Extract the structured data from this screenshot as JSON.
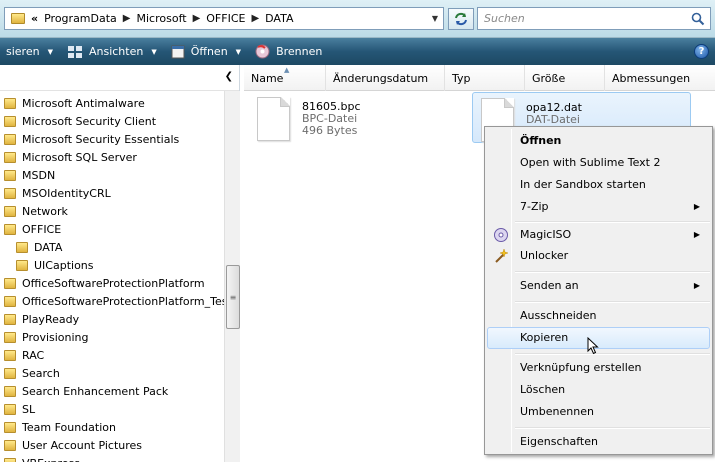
{
  "address": {
    "chevron": "«",
    "crumbs": [
      "ProgramData",
      "Microsoft",
      "OFFICE",
      "DATA"
    ],
    "separator": "▶",
    "dropdown": "▼"
  },
  "search": {
    "placeholder": "Suchen"
  },
  "toolbar": {
    "organize_label": "sieren",
    "views_label": "Ansichten",
    "open_label": "Öffnen",
    "burn_label": "Brennen",
    "arrow": "▼",
    "help_label": "?"
  },
  "nav": {
    "chevron": "❮",
    "items": [
      {
        "label": "Microsoft Antimalware"
      },
      {
        "label": "Microsoft Security Client"
      },
      {
        "label": "Microsoft Security Essentials"
      },
      {
        "label": "Microsoft SQL Server"
      },
      {
        "label": "MSDN"
      },
      {
        "label": "MSOIdentityCRL"
      },
      {
        "label": "Network"
      },
      {
        "label": "OFFICE"
      },
      {
        "label": "DATA"
      },
      {
        "label": "UICaptions"
      },
      {
        "label": "OfficeSoftwareProtectionPlatform"
      },
      {
        "label": "OfficeSoftwareProtectionPlatform_Test"
      },
      {
        "label": "PlayReady"
      },
      {
        "label": "Provisioning"
      },
      {
        "label": "RAC"
      },
      {
        "label": "Search"
      },
      {
        "label": "Search Enhancement Pack"
      },
      {
        "label": "SL"
      },
      {
        "label": "Team Foundation"
      },
      {
        "label": "User Account Pictures"
      },
      {
        "label": "VBExpress"
      }
    ],
    "scroll_grip": "≡"
  },
  "columns": [
    "Name",
    "Änderungsdatum",
    "Typ",
    "Größe",
    "Abmessungen"
  ],
  "sort_indicator": "▲",
  "files": [
    {
      "name": "81605.bpc",
      "type": "BPC-Datei",
      "size": "496 Bytes"
    },
    {
      "name": "opa12.dat",
      "type": "DAT-Datei"
    }
  ],
  "context_menu": {
    "submenu_arrow": "▶",
    "items": [
      {
        "label": "Öffnen"
      },
      {
        "label": "Open with Sublime Text 2"
      },
      {
        "label": "In der Sandbox starten"
      },
      {
        "label": "7-Zip"
      },
      {
        "label": "MagicISO"
      },
      {
        "label": "Unlocker"
      },
      {
        "label": "Senden an"
      },
      {
        "label": "Ausschneiden"
      },
      {
        "label": "Kopieren"
      },
      {
        "label": "Verknüpfung erstellen"
      },
      {
        "label": "Löschen"
      },
      {
        "label": "Umbenennen"
      },
      {
        "label": "Eigenschaften"
      }
    ]
  },
  "colors": {
    "toolbar": "#255676",
    "highlight": "#d8ebfc",
    "address_bg": "#c9e3ee"
  }
}
